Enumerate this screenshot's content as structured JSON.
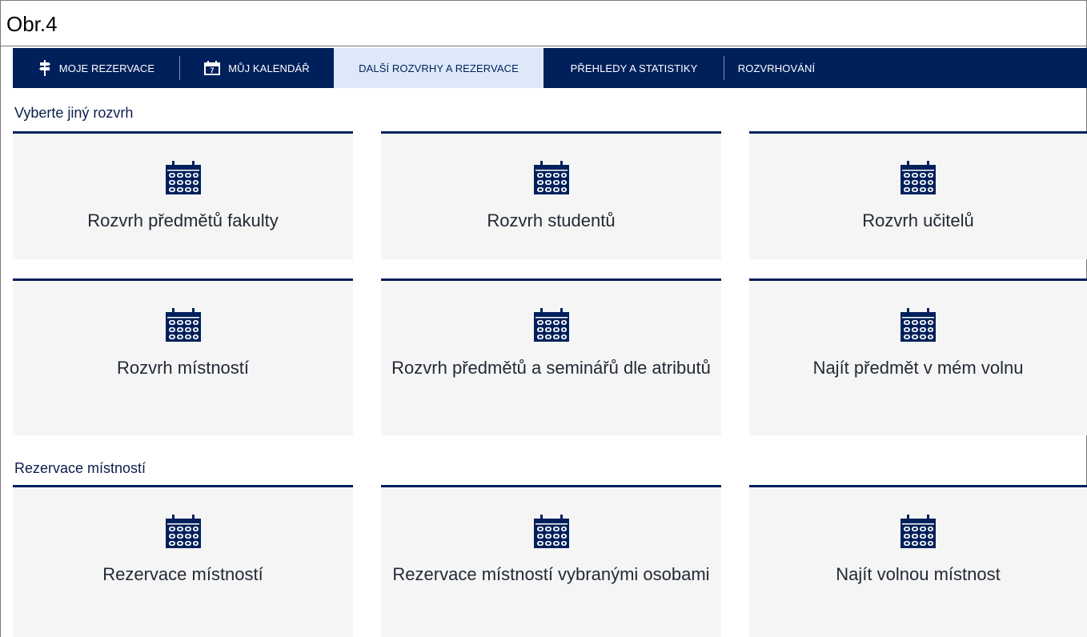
{
  "figure_label": "Obr.4",
  "nav": {
    "items": [
      {
        "label": "MOJE REZERVACE",
        "icon": "signpost-icon"
      },
      {
        "label": "MŮJ KALENDÁŘ",
        "icon": "calendar-7-icon"
      },
      {
        "label": "DALŠÍ ROZVRHY A REZERVACE",
        "active": true
      },
      {
        "label": "PŘEHLEDY A STATISTIKY"
      },
      {
        "label": "ROZVRHOVÁNÍ"
      }
    ],
    "calendar_day": "7"
  },
  "sections": [
    {
      "title": "Vyberte jiný rozvrh",
      "cards": [
        {
          "label": "Rozvrh předmětů fakulty",
          "icon": "calendar-icon"
        },
        {
          "label": "Rozvrh studentů",
          "icon": "calendar-icon"
        },
        {
          "label": "Rozvrh učitelů",
          "icon": "calendar-icon"
        },
        {
          "label": "Rozvrh místností",
          "icon": "calendar-icon"
        },
        {
          "label": "Rozvrh předmětů a seminářů dle atributů",
          "icon": "calendar-icon"
        },
        {
          "label": "Najít předmět v mém volnu",
          "icon": "calendar-icon"
        }
      ]
    },
    {
      "title": "Rezervace místností",
      "cards": [
        {
          "label": "Rezervace místností",
          "icon": "calendar-icon"
        },
        {
          "label": "Rezervace místností vybranými osobami",
          "icon": "calendar-icon"
        },
        {
          "label": "Najít volnou místnost",
          "icon": "calendar-icon"
        }
      ]
    }
  ],
  "colors": {
    "navy": "#00205b",
    "active_tab": "#dde9f8",
    "card_bg": "#f5f5f5"
  }
}
